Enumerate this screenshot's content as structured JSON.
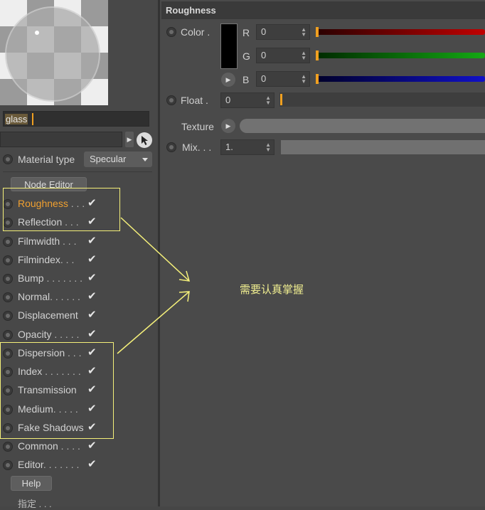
{
  "material": {
    "name": "glass",
    "type_label": "Material type",
    "type_value": "Specular"
  },
  "buttons": {
    "node_editor": "Node Editor",
    "help": "Help"
  },
  "channels": [
    {
      "label": "Roughness",
      "dots": " . . .",
      "active": true,
      "checked": "✔"
    },
    {
      "label": "Reflection",
      "dots": " . . .",
      "active": false,
      "checked": "✔"
    },
    {
      "label": "Filmwidth",
      "dots": " . . .",
      "active": false,
      "checked": "✔"
    },
    {
      "label": "Filmindex",
      "dots": ". . .",
      "active": false,
      "checked": "✔"
    },
    {
      "label": "Bump",
      "dots": " . . . . . . .",
      "active": false,
      "checked": "✔"
    },
    {
      "label": "Normal",
      "dots": ". . . . . .",
      "active": false,
      "checked": "✔"
    },
    {
      "label": "Displacement",
      "dots": "",
      "active": false,
      "checked": "✔"
    },
    {
      "label": "Opacity",
      "dots": " . . . . .",
      "active": false,
      "checked": "✔"
    },
    {
      "label": "Dispersion",
      "dots": " . . .",
      "active": false,
      "checked": "✔"
    },
    {
      "label": "Index",
      "dots": " . . . . . . .",
      "active": false,
      "checked": "✔"
    },
    {
      "label": "Transmission",
      "dots": "",
      "active": false,
      "checked": "✔"
    },
    {
      "label": "Medium",
      "dots": ". . . . .",
      "active": false,
      "checked": "✔"
    },
    {
      "label": "Fake Shadows",
      "dots": "",
      "active": false,
      "checked": "✔"
    },
    {
      "label": "Common",
      "dots": " . . . .",
      "active": false,
      "checked": "✔"
    },
    {
      "label": "Editor",
      "dots": ". . . . . . .",
      "active": false,
      "checked": "✔"
    }
  ],
  "assign_label": "指定 . . .",
  "panel": {
    "section_title": "Roughness",
    "color_label": "Color .",
    "r_label": "R",
    "g_label": "G",
    "b_label": "B",
    "r_value": "0",
    "g_value": "0",
    "b_value": "0",
    "float_label": "Float .",
    "float_value": "0",
    "texture_label": "Texture",
    "mix_label": "Mix. . .",
    "mix_value": "1."
  },
  "annotation": "需要认真掌握",
  "colors": {
    "accent": "#f0a030",
    "highlight": "#f5f07a",
    "red": "#c00000",
    "green": "#14a814",
    "blue": "#1010c8"
  },
  "icons": [
    "radio-icon",
    "checkmark-icon",
    "picker-icon",
    "arrow-right-icon",
    "spin-icon",
    "chevron-down-icon"
  ]
}
